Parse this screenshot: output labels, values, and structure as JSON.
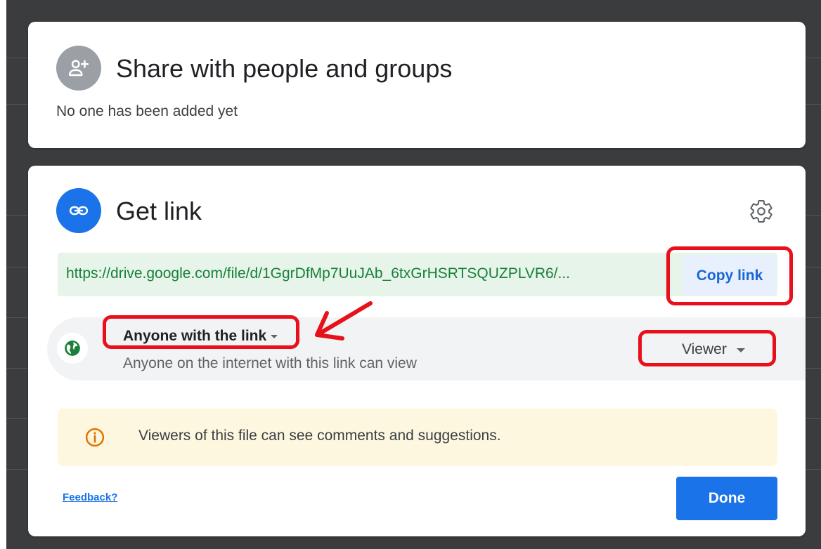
{
  "share_section": {
    "title": "Share with people and groups",
    "subtitle": "No one has been added yet",
    "icon": "person-add-icon"
  },
  "link_section": {
    "title": "Get link",
    "icon": "link-icon",
    "settings_icon": "gear-icon",
    "url": "https://drive.google.com/file/d/1GgrDfMp7UuJAb_6txGrHSRTSQUZPLVR6/...",
    "copy_label": "Copy link",
    "access": {
      "selected": "Anyone with the link",
      "description": "Anyone on the internet with this link can view",
      "icon": "globe-icon"
    },
    "role": {
      "selected": "Viewer"
    },
    "info": {
      "text": "Viewers of this file can see comments and suggestions.",
      "icon": "info-icon"
    },
    "feedback_label": "Feedback?",
    "done_label": "Done"
  },
  "colors": {
    "accent": "#1a73e8",
    "url_text": "#188038",
    "url_background": "#e6f4ea",
    "info_background": "#fef7e0",
    "annotation_red": "#e8101a"
  }
}
